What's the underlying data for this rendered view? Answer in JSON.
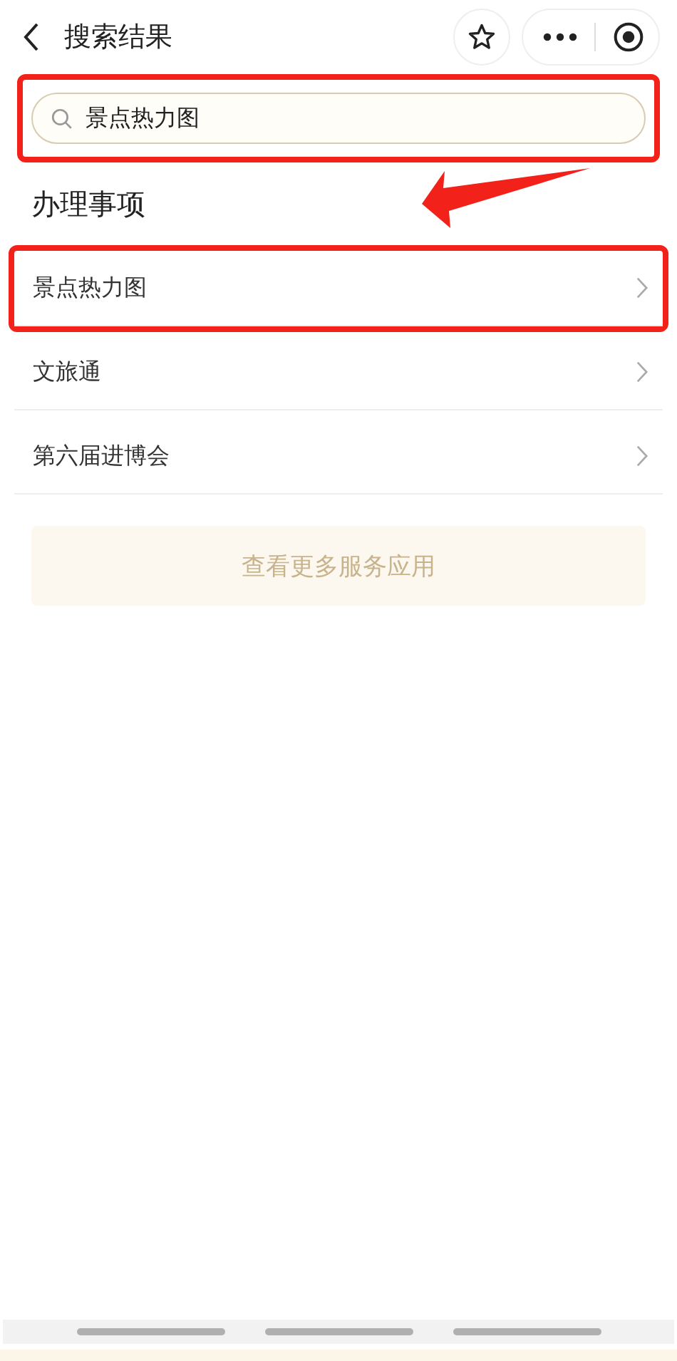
{
  "header": {
    "title": "搜索结果"
  },
  "search": {
    "value": "景点热力图",
    "highlighted": true
  },
  "section": {
    "title": "办理事项",
    "arrow": true
  },
  "items": [
    {
      "label": "景点热力图",
      "highlighted": true
    },
    {
      "label": "文旅通",
      "highlighted": false
    },
    {
      "label": "第六届进博会",
      "highlighted": false
    }
  ],
  "more_button": "查看更多服务应用"
}
